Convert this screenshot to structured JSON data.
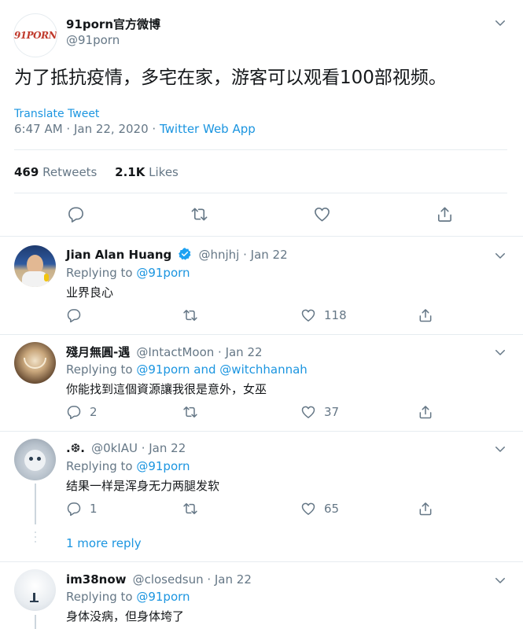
{
  "main_tweet": {
    "logo_text": "91PORN",
    "display_name": "91porn官方微博",
    "handle": "@91porn",
    "text": "为了抵抗疫情，多宅在家，游客可以观看100部视频。",
    "translate_label": "Translate Tweet",
    "timestamp": "6:47 AM · Jan 22, 2020 · ",
    "source": "Twitter Web App",
    "retweets_count": "469",
    "retweets_label": "Retweets",
    "likes_count": "2.1K",
    "likes_label": "Likes"
  },
  "replies": [
    {
      "name": "Jian Alan Huang",
      "verified": true,
      "handle_date": "@hnjhj · Jan 22",
      "replying_prefix": "Replying to ",
      "replying_to": "@91porn",
      "text": "业界良心",
      "reply_count": "",
      "retweet_count": "",
      "like_count": "118"
    },
    {
      "name": "殘月無圓-遇",
      "handle_date": "@IntactMoon · Jan 22",
      "replying_prefix": "Replying to ",
      "replying_to": "@91porn and @witchhannah",
      "text": "你能找到這個資源讓我很是意外，女巫",
      "reply_count": "2",
      "retweet_count": "",
      "like_count": "37"
    },
    {
      "name": ".❆.",
      "handle_date": "@0kIAU · Jan 22",
      "replying_prefix": "Replying to ",
      "replying_to": "@91porn",
      "text": "结果一样是浑身无力两腿发软",
      "reply_count": "1",
      "retweet_count": "",
      "like_count": "65"
    },
    {
      "name": "im38now",
      "handle_date": "@closedsun · Jan 22",
      "replying_prefix": "Replying to ",
      "replying_to": "@91porn",
      "text": "身体没病，但身体垮了"
    }
  ],
  "more_replies_label": "1 more reply",
  "colors": {
    "accent": "#1b95e0",
    "muted": "#657786",
    "divider": "#e6ecf0",
    "verified": "#1da1f2",
    "logo_red": "#c0392b"
  }
}
